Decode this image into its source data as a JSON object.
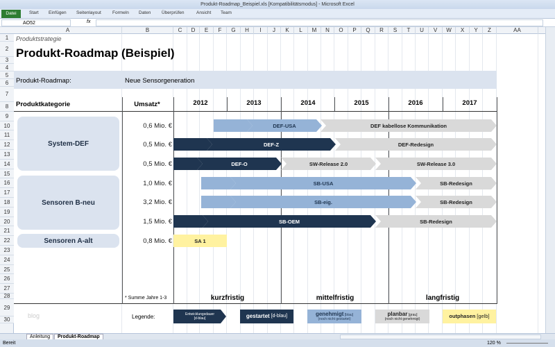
{
  "window": {
    "title": "Produkt-Roadmap_Beispiel.xls [Kompatibilitätsmodus] - Microsoft Excel"
  },
  "ribbon": {
    "tabs": [
      "Datei",
      "Start",
      "Einfügen",
      "Seitenlayout",
      "Formeln",
      "Daten",
      "Überprüfen",
      "Ansicht",
      "Team"
    ]
  },
  "formula_bar": {
    "name_box": "AO52",
    "fx": "fx",
    "value": ""
  },
  "columns": [
    "A",
    "B",
    "C",
    "D",
    "E",
    "F",
    "G",
    "H",
    "I",
    "J",
    "K",
    "L",
    "M",
    "N",
    "O",
    "P",
    "Q",
    "R",
    "S",
    "T",
    "U",
    "V",
    "W",
    "X",
    "Y",
    "Z",
    "AA"
  ],
  "rows": [
    "1",
    "2",
    "3",
    "4",
    "5",
    "6",
    "7",
    "8",
    "9",
    "10",
    "11",
    "12",
    "13",
    "14",
    "15",
    "16",
    "17",
    "18",
    "19",
    "20",
    "21",
    "22",
    "23",
    "24",
    "25",
    "26",
    "27",
    "28",
    "29",
    "30"
  ],
  "sheet": {
    "subtitle": "Produktstrategie",
    "title": "Produkt-Roadmap (Beispiel)",
    "roadmap_label": "Produkt-Roadmap:",
    "roadmap_value": "Neue Sensorgeneration",
    "header_category": "Produktkategorie",
    "header_revenue": "Umsatz*",
    "years": [
      "2012",
      "2013",
      "2014",
      "2015",
      "2016",
      "2017"
    ],
    "categories": [
      "System-DEF",
      "Sensoren B-neu",
      "Sensoren A-alt"
    ],
    "revenues": [
      "0,6 Mio. €",
      "0,5 Mio. €",
      "0,5 Mio. €",
      "1,0 Mio. €",
      "3,2 Mio. €",
      "1,5 Mio. €",
      "0,8 Mio. €"
    ],
    "bars": {
      "r9": [
        "DEF-USA",
        "DEF kabellose Kommunikation"
      ],
      "r11": [
        "DEF-Z",
        "DEF-Redesign"
      ],
      "r13": [
        "DEF-O",
        "SW-Release 2.0",
        "SW-Release 3.0"
      ],
      "r15": [
        "SB-USA",
        "SB-Redesign"
      ],
      "r17": [
        "SB-eig.",
        "SB-Redesign"
      ],
      "r19": [
        "SB-OEM",
        "SB-Redesign"
      ],
      "r21": [
        "SA 1"
      ]
    },
    "footnote": "* Summe Jahre 1-3",
    "terms": [
      "kurzfristig",
      "mittelfristig",
      "langfristig"
    ],
    "blog": "blog",
    "legend_label": "Legende:",
    "legend": [
      {
        "main": "Entwicklungsdauer",
        "sub": "[d-blau]"
      },
      {
        "main": "gestartet",
        "sub": "[d-blau]"
      },
      {
        "main": "genehmigt",
        "tag": "[blau]",
        "sub": "(noch nicht gestartet)"
      },
      {
        "main": "planbar",
        "tag": "[grau]",
        "sub": "(noch nicht genehmigt)"
      },
      {
        "main": "outphasen",
        "sub": "[gelb]"
      }
    ]
  },
  "sheet_tabs": [
    "Anleitung",
    "Produkt-Roadmap"
  ],
  "status": {
    "ready": "Bereit",
    "zoom": "120 %"
  },
  "colors": {
    "dark_blue": "#1f3550",
    "blue": "#95b3d7",
    "gray": "#d9d9d9",
    "yellow": "#fff2a0"
  }
}
